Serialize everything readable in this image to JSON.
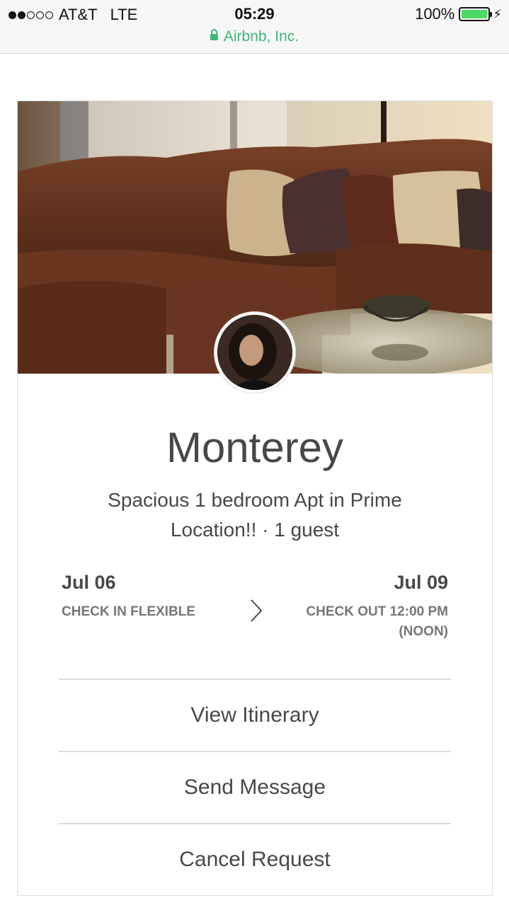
{
  "status_bar": {
    "carrier": "AT&T",
    "network": "LTE",
    "time": "05:29",
    "battery": "100%",
    "battery_level": 1.0,
    "site": "Airbnb, Inc.",
    "signal_bars_filled": 2,
    "signal_bars_total": 5
  },
  "listing": {
    "title": "Monterey",
    "subtitle": "Spacious 1 bedroom Apt in Prime Location!! · 1 guest"
  },
  "check_in": {
    "date": "Jul 06",
    "label": "CHECK IN FLEXIBLE"
  },
  "check_out": {
    "date": "Jul 09",
    "label": "CHECK OUT 12:00 PM (NOON)"
  },
  "actions": {
    "view_itinerary": "View Itinerary",
    "send_message": "Send Message",
    "cancel_request": "Cancel Request"
  },
  "colors": {
    "site_green": "#3cb878",
    "text": "#484848",
    "muted": "#767676",
    "battery": "#4cd964"
  }
}
